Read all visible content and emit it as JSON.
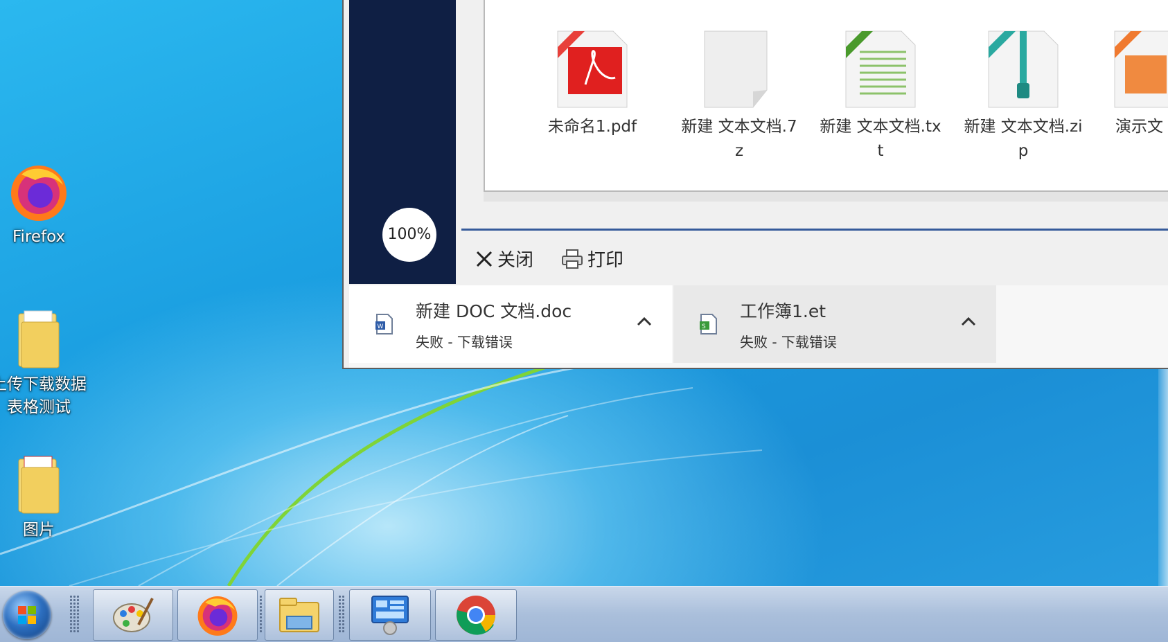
{
  "desktop": {
    "icons": [
      {
        "label": "Firefox"
      },
      {
        "label": "上传下载数据表格测试"
      },
      {
        "label": "图片"
      }
    ]
  },
  "window": {
    "zoom": "100%",
    "files": [
      {
        "name": "未命名1.pdf",
        "badge": "PDF",
        "badge_color": "#e8403a"
      },
      {
        "name": "新建 文本文档.7z",
        "badge": "",
        "badge_color": "#d9d9d9"
      },
      {
        "name": "新建 文本文档.txt",
        "badge": "TEXT",
        "badge_color": "#4a9a2c"
      },
      {
        "name": "新建 文本文档.zip",
        "badge": "ZIP",
        "badge_color": "#2aa9a0"
      },
      {
        "name": "演示文",
        "badge": "PPTX",
        "badge_color": "#f07a30"
      }
    ],
    "actions": {
      "close_label": "关闭",
      "print_label": "打印"
    }
  },
  "downloads": [
    {
      "name": "新建 DOC 文档.doc",
      "status": "失败 - 下载错误",
      "icon": "word-file-icon"
    },
    {
      "name": "工作簿1.et",
      "status": "失败 - 下载错误",
      "icon": "spreadsheet-file-icon"
    }
  ],
  "taskbar": {
    "items": [
      "paint-icon",
      "firefox-icon",
      "file-explorer-icon",
      "control-panel-icon",
      "chrome-icon"
    ]
  }
}
